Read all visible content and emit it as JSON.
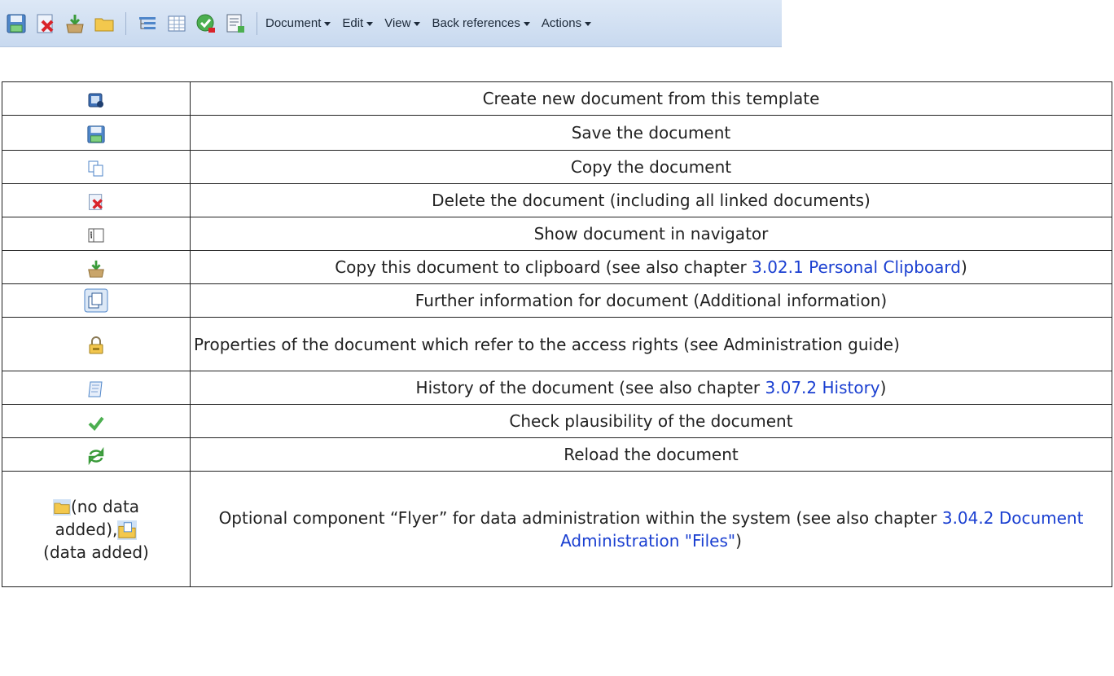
{
  "toolbar": {
    "icons": [
      "save-icon",
      "delete-icon",
      "clipboard-icon",
      "folder-icon",
      "navigator-icon",
      "table-icon",
      "plausibility-icon",
      "calculate-icon"
    ],
    "menus": [
      {
        "label": "Document"
      },
      {
        "label": "Edit"
      },
      {
        "label": "View"
      },
      {
        "label": "Back references"
      },
      {
        "label": "Actions"
      }
    ]
  },
  "rows": [
    {
      "icon": "create-from-template-icon",
      "text": "Create new document from this template"
    },
    {
      "icon": "save-icon",
      "text": "Save the document"
    },
    {
      "icon": "copy-icon",
      "text": "Copy the document"
    },
    {
      "icon": "delete-icon",
      "text": "Delete the document (including all linked documents)"
    },
    {
      "icon": "navigator-icon",
      "text": "Show document in navigator"
    },
    {
      "icon": "clipboard-icon",
      "before": "Copy this document to clipboard (see also chapter ",
      "link": "3.02.1 Personal Clipboard",
      "after": ")"
    },
    {
      "icon": "further-info-icon",
      "text": "Further information for document (Additional information)"
    },
    {
      "icon": "lock-icon",
      "text": "Properties of the document which refer to the access rights (see Administration guide)"
    },
    {
      "icon": "history-icon",
      "before": "History of the document (see also chapter ",
      "link": "3.07.2 History",
      "after": ")"
    },
    {
      "icon": "check-icon",
      "text": "Check plausibility of the document"
    },
    {
      "icon": "reload-icon",
      "text": "Reload the document"
    },
    {
      "icon_labels": {
        "no_data": "(no data",
        "no_data_2": "added),",
        "with_data": "(data added)"
      },
      "before": "Optional component “Flyer” for data administration within the system (see also chapter ",
      "link": "3.04.2 Document Administration \"Files\"",
      "after": ")"
    }
  ],
  "colors": {
    "toolbar_bg": "#c8d9ef",
    "link": "#1a3fd1",
    "border": "#222222"
  }
}
